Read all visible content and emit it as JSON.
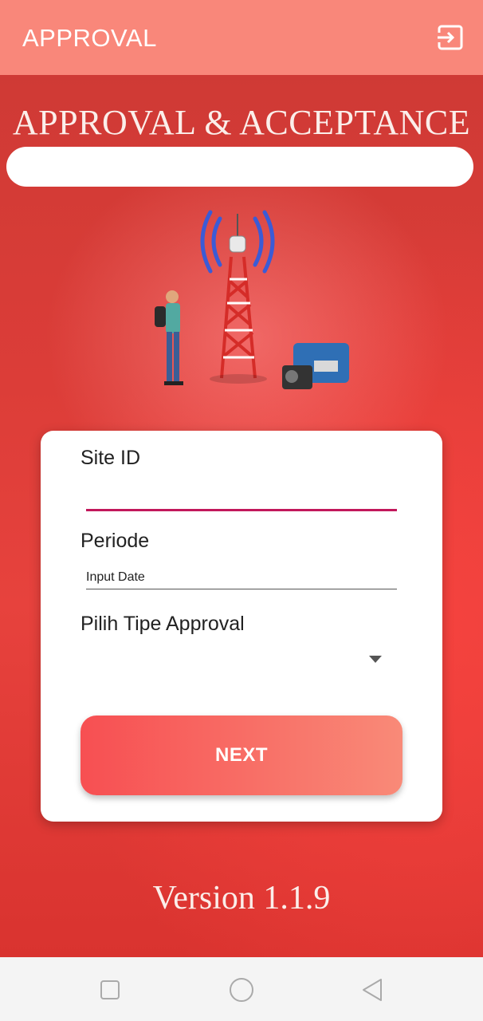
{
  "app_bar": {
    "title": "APPROVAL",
    "logout_icon": "logout-icon"
  },
  "hero": {
    "title": "APPROVAL & ACCEPTANCE",
    "illustration": "telecom-tower-technician-generator"
  },
  "form": {
    "site_id": {
      "label": "Site ID",
      "value": ""
    },
    "periode": {
      "label": "Periode",
      "placeholder": "Input Date",
      "value": ""
    },
    "tipe_approval": {
      "label": "Pilih Tipe Approval",
      "selected": ""
    },
    "next_label": "NEXT"
  },
  "footer": {
    "version": "Version 1.1.9"
  },
  "nav_bar": {
    "icons": [
      "recent-apps-icon",
      "home-icon",
      "back-icon"
    ]
  },
  "colors": {
    "app_bar": "#f9877a",
    "accent": "#c2185b",
    "button_start": "#f74f52",
    "button_end": "#f98a78",
    "background": "#dc3d38"
  }
}
